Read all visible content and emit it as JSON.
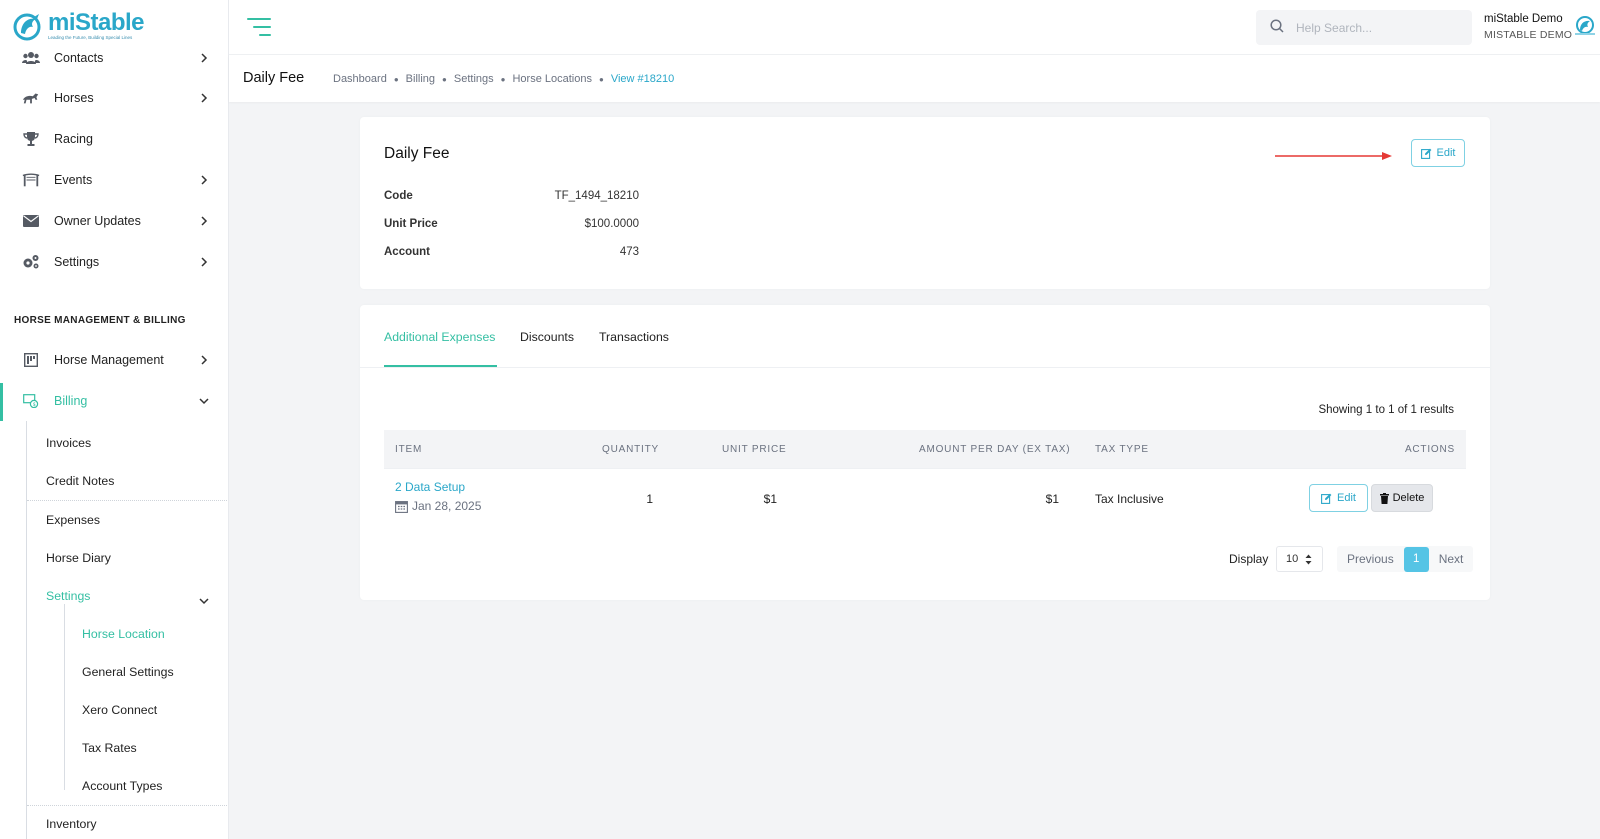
{
  "brand": {
    "name": "miStable",
    "tagline": "Leading the Future, Building Special Lines",
    "color": "#2aa7c9",
    "accent": "#34bfa3"
  },
  "sidebar": {
    "items": [
      {
        "label": "Contacts",
        "icon": "contacts-icon"
      },
      {
        "label": "Horses",
        "icon": "horse-icon"
      },
      {
        "label": "Racing",
        "icon": "trophy-icon"
      },
      {
        "label": "Events",
        "icon": "events-icon"
      },
      {
        "label": "Owner Updates",
        "icon": "envelope-icon"
      },
      {
        "label": "Settings",
        "icon": "gears-icon"
      }
    ],
    "section_title": "HORSE MANAGEMENT & BILLING",
    "section_items": [
      {
        "label": "Horse Management",
        "icon": "horse-management-icon"
      },
      {
        "label": "Billing",
        "icon": "billing-icon"
      }
    ],
    "billing_sub": [
      "Invoices",
      "Credit Notes",
      "Expenses",
      "Horse Diary",
      "Settings"
    ],
    "settings_sub": [
      "Horse Location",
      "General Settings",
      "Xero Connect",
      "Tax Rates",
      "Account Types"
    ],
    "after": [
      "Inventory"
    ]
  },
  "header": {
    "search_placeholder": "Help Search...",
    "user_name": "miStable Demo",
    "user_org": "MISTABLE DEMO"
  },
  "subheader": {
    "title": "Daily Fee",
    "breadcrumb": [
      "Dashboard",
      "Billing",
      "Settings",
      "Horse Locations",
      "View #18210"
    ]
  },
  "detail": {
    "title": "Daily Fee",
    "edit_label": "Edit",
    "fields": [
      {
        "label": "Code",
        "value": "TF_1494_18210"
      },
      {
        "label": "Unit Price",
        "value": "$100.0000"
      },
      {
        "label": "Account",
        "value": "473"
      }
    ]
  },
  "tabs": [
    "Additional Expenses",
    "Discounts",
    "Transactions"
  ],
  "table": {
    "showing": "Showing 1 to 1 of 1 results",
    "headers": [
      "ITEM",
      "QUANTITY",
      "UNIT PRICE",
      "AMOUNT PER DAY (EX TAX)",
      "TAX TYPE",
      "ACTIONS"
    ],
    "rows": [
      {
        "item": "2 Data Setup",
        "date": "Jan 28, 2025",
        "quantity": "1",
        "unit_price": "$1",
        "amount": "$1",
        "tax_type": "Tax Inclusive",
        "edit": "Edit",
        "delete": "Delete"
      }
    ]
  },
  "pagination": {
    "display_label": "Display",
    "page_size": "10",
    "previous": "Previous",
    "current": "1",
    "next": "Next"
  }
}
